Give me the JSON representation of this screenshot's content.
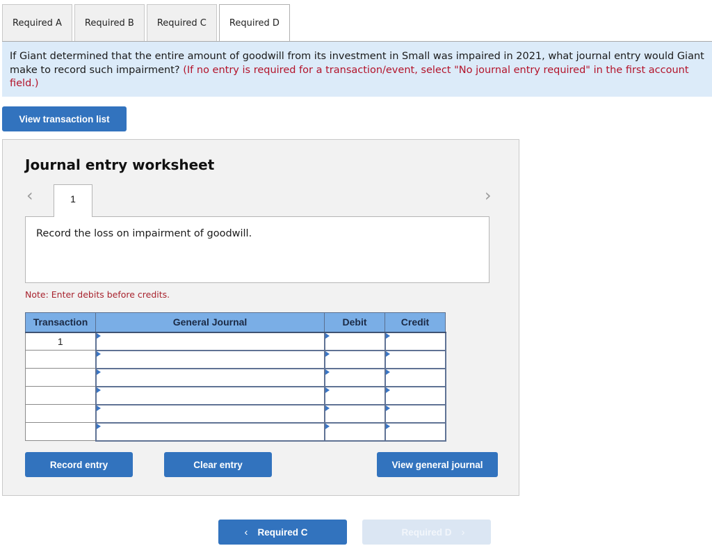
{
  "tabs": [
    {
      "label": "Required A",
      "active": false
    },
    {
      "label": "Required B",
      "active": false
    },
    {
      "label": "Required C",
      "active": false
    },
    {
      "label": "Required D",
      "active": true
    }
  ],
  "question": {
    "text": "If Giant determined that the entire amount of goodwill from its investment in Small was impaired in 2021, what journal entry would Giant make to record such impairment?",
    "hint": "(If no entry is required for a transaction/event, select \"No journal entry required\" in the first account field.)"
  },
  "buttons": {
    "view_transaction_list": "View transaction list",
    "record_entry": "Record entry",
    "clear_entry": "Clear entry",
    "view_general_journal": "View general journal"
  },
  "worksheet": {
    "title": "Journal entry worksheet",
    "prev_icon": "chevron-left-icon",
    "next_icon": "chevron-right-icon",
    "current_entry": "1",
    "description": "Record the loss on impairment of goodwill.",
    "note": "Note: Enter debits before credits."
  },
  "journal_table": {
    "headers": {
      "transaction": "Transaction",
      "general_journal": "General Journal",
      "debit": "Debit",
      "credit": "Credit"
    },
    "rows": [
      {
        "transaction": "1",
        "account": "",
        "debit": "",
        "credit": ""
      },
      {
        "transaction": "",
        "account": "",
        "debit": "",
        "credit": ""
      },
      {
        "transaction": "",
        "account": "",
        "debit": "",
        "credit": ""
      },
      {
        "transaction": "",
        "account": "",
        "debit": "",
        "credit": ""
      },
      {
        "transaction": "",
        "account": "",
        "debit": "",
        "credit": ""
      },
      {
        "transaction": "",
        "account": "",
        "debit": "",
        "credit": ""
      }
    ]
  },
  "bottom_nav": {
    "prev_label": "Required C",
    "prev_icon": "chevron-left-icon",
    "next_label": "Required D",
    "next_icon": "chevron-right-icon",
    "next_disabled": true
  },
  "colors": {
    "primary_button": "#3273be",
    "question_bg": "#dcebf9",
    "hint_red": "#b3132a",
    "table_header": "#7aaee6",
    "disabled_button": "#dbe6f3"
  }
}
